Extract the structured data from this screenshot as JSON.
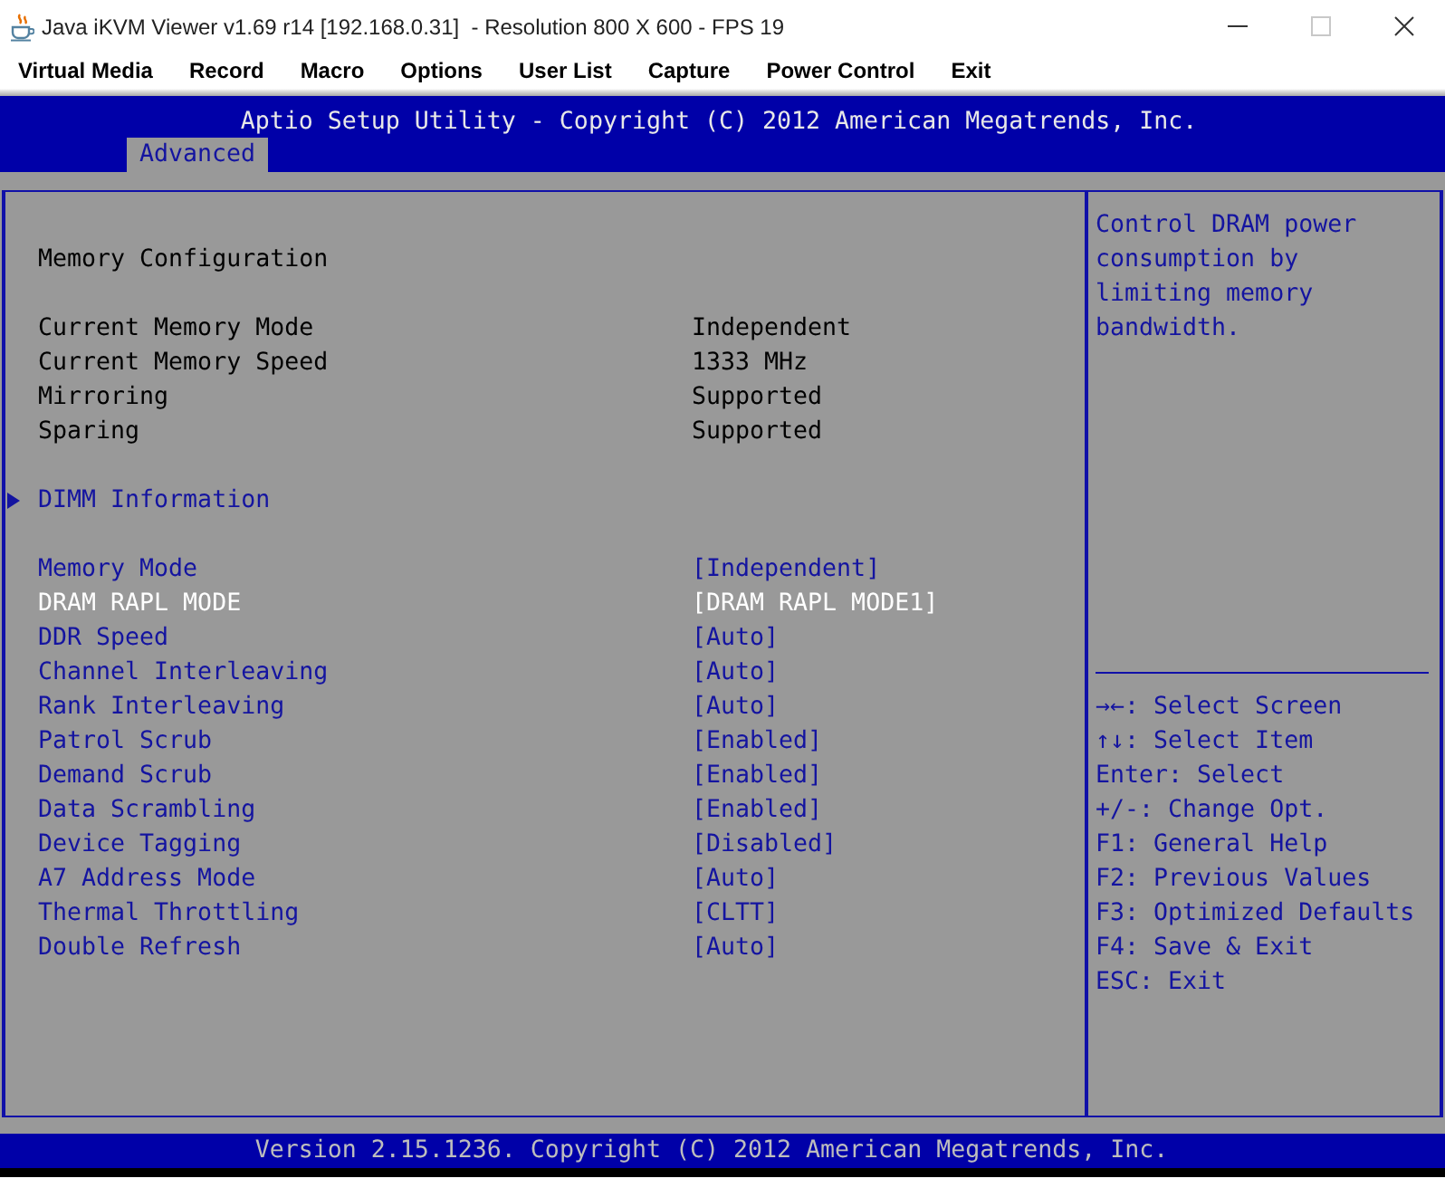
{
  "window": {
    "title": "Java iKVM Viewer v1.69 r14 [192.168.0.31]  - Resolution 800 X 600 - FPS 19",
    "controls": [
      {
        "kind": "minimize",
        "disabled": false
      },
      {
        "kind": "maximize",
        "disabled": true
      },
      {
        "kind": "close",
        "disabled": false
      }
    ]
  },
  "menu_bar": [
    "Virtual Media",
    "Record",
    "Macro",
    "Options",
    "User List",
    "Capture",
    "Power Control",
    "Exit"
  ],
  "bios": {
    "title": "Aptio Setup Utility - Copyright (C) 2012 American Megatrends, Inc.",
    "tabs": [
      {
        "label": "Advanced",
        "selected": true
      }
    ],
    "sections": [
      {
        "items": [
          {
            "kind": "heading",
            "label": "Memory Configuration"
          }
        ]
      },
      {
        "items": [
          {
            "kind": "info",
            "label": "Current Memory Mode",
            "value": "Independent"
          },
          {
            "kind": "info",
            "label": "Current Memory Speed",
            "value": "1333 MHz"
          },
          {
            "kind": "info",
            "label": "Mirroring",
            "value": "Supported"
          },
          {
            "kind": "info",
            "label": "Sparing",
            "value": "Supported"
          }
        ]
      },
      {
        "items": [
          {
            "kind": "submenu",
            "label": "DIMM Information",
            "selected": false
          }
        ]
      },
      {
        "items": [
          {
            "kind": "option",
            "label": "Memory Mode",
            "value": "[Independent]",
            "selected": false
          },
          {
            "kind": "option",
            "label": "DRAM RAPL MODE",
            "value": "[DRAM RAPL MODE1]",
            "selected": true
          },
          {
            "kind": "option",
            "label": "DDR Speed",
            "value": "[Auto]",
            "selected": false
          },
          {
            "kind": "option",
            "label": "Channel Interleaving",
            "value": "[Auto]",
            "selected": false
          },
          {
            "kind": "option",
            "label": "Rank Interleaving",
            "value": "[Auto]",
            "selected": false
          },
          {
            "kind": "option",
            "label": "Patrol Scrub",
            "value": "[Enabled]",
            "selected": false
          },
          {
            "kind": "option",
            "label": "Demand Scrub",
            "value": "[Enabled]",
            "selected": false
          },
          {
            "kind": "option",
            "label": "Data Scrambling",
            "value": "[Enabled]",
            "selected": false
          },
          {
            "kind": "option",
            "label": "Device Tagging",
            "value": "[Disabled]",
            "selected": false
          },
          {
            "kind": "option",
            "label": "A7 Address Mode",
            "value": "[Auto]",
            "selected": false
          },
          {
            "kind": "option",
            "label": "Thermal Throttling",
            "value": "[CLTT]",
            "selected": false
          },
          {
            "kind": "option",
            "label": "Double Refresh",
            "value": "[Auto]",
            "selected": false
          }
        ]
      }
    ],
    "help": {
      "description": "Control DRAM power consumption by limiting memory bandwidth.",
      "keys": [
        "→←: Select Screen",
        "↑↓: Select Item",
        "Enter: Select",
        "+/-: Change Opt.",
        "F1: General Help",
        "F2: Previous Values",
        "F3: Optimized Defaults",
        "F4: Save & Exit",
        "ESC: Exit"
      ]
    },
    "footer": "Version 2.15.1236. Copyright (C) 2012 American Megatrends, Inc."
  }
}
